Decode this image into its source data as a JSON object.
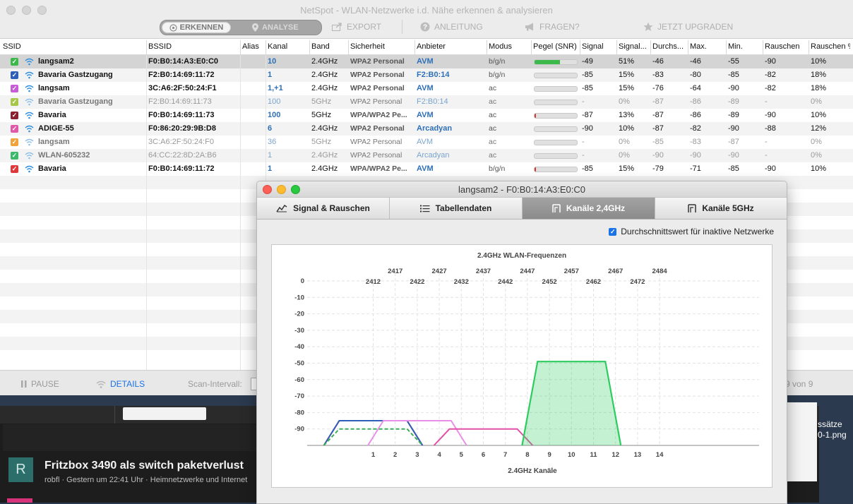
{
  "window": {
    "title": "NetSpot - WLAN-Netzwerke i.d. Nähe erkennen & analysieren"
  },
  "toolbar": {
    "mode_discover": "ERKENNEN",
    "mode_analyze": "ANALYSE",
    "export": "EXPORT",
    "guide": "ANLEITUNG",
    "ask": "FRAGEN?",
    "upgrade": "JETZT UPGRADEN"
  },
  "table": {
    "headers": [
      "SSID",
      "BSSID",
      "Alias",
      "Kanal",
      "Band",
      "Sicherheit",
      "Anbieter",
      "Modus",
      "Pegel (SNR)",
      "Signal",
      "Signal...",
      "Durchs...",
      "Max.",
      "Min.",
      "Rauschen",
      "Rauschen %"
    ],
    "rows": [
      {
        "color": "#3cb94a",
        "ssid": "langsam2",
        "bssid": "F0:B0:14:A3:E0:C0",
        "alias": "",
        "channel": "10",
        "band": "2.4GHz",
        "security": "WPA2 Personal",
        "vendor": "AVM",
        "mode": "b/g/n",
        "level": 0.6,
        "level_color": "#3cb94a",
        "signal": "-49",
        "signal_pct": "51%",
        "avg": "-46",
        "max": "-46",
        "min": "-55",
        "noise": "-90",
        "noise_pct": "10%",
        "active": true
      },
      {
        "color": "#2d5fb8",
        "ssid": "Bavaria Gastzugang",
        "bssid": "F2:B0:14:69:11:72",
        "alias": "",
        "channel": "1",
        "band": "2.4GHz",
        "security": "WPA2 Personal",
        "vendor": "F2:B0:14",
        "mode": "b/g/n",
        "level": 0.0,
        "level_color": "#d23a3a",
        "signal": "-85",
        "signal_pct": "15%",
        "avg": "-83",
        "max": "-80",
        "min": "-85",
        "noise": "-82",
        "noise_pct": "18%",
        "active": true
      },
      {
        "color": "#c85bd8",
        "ssid": "langsam",
        "bssid": "3C:A6:2F:50:24:F1",
        "alias": "",
        "channel": "1,+1",
        "band": "2.4GHz",
        "security": "WPA2 Personal",
        "vendor": "AVM",
        "mode": "ac",
        "level": 0.0,
        "level_color": "#d23a3a",
        "signal": "-85",
        "signal_pct": "15%",
        "avg": "-76",
        "max": "-64",
        "min": "-90",
        "noise": "-82",
        "noise_pct": "18%",
        "active": true
      },
      {
        "color": "#a7c74a",
        "ssid": "Bavaria Gastzugang",
        "bssid": "F2:B0:14:69:11:73",
        "alias": "",
        "channel": "100",
        "band": "5GHz",
        "security": "WPA2 Personal",
        "vendor": "F2:B0:14",
        "mode": "ac",
        "level": 0.0,
        "level_color": "#d23a3a",
        "signal": "-",
        "signal_pct": "0%",
        "avg": "-87",
        "max": "-86",
        "min": "-89",
        "noise": "-",
        "noise_pct": "0%",
        "active": false
      },
      {
        "color": "#8b1f2e",
        "ssid": "Bavaria",
        "bssid": "F0:B0:14:69:11:73",
        "alias": "",
        "channel": "100",
        "band": "5GHz",
        "security": "WPA/WPA2 Pe...",
        "vendor": "AVM",
        "mode": "ac",
        "level": 0.04,
        "level_color": "#d23a3a",
        "signal": "-87",
        "signal_pct": "13%",
        "avg": "-87",
        "max": "-86",
        "min": "-89",
        "noise": "-90",
        "noise_pct": "10%",
        "active": true
      },
      {
        "color": "#e158a8",
        "ssid": "ADIGE-55",
        "bssid": "F0:86:20:29:9B:D8",
        "alias": "",
        "channel": "6",
        "band": "2.4GHz",
        "security": "WPA2 Personal",
        "vendor": "Arcadyan",
        "mode": "ac",
        "level": 0.0,
        "level_color": "#d23a3a",
        "signal": "-90",
        "signal_pct": "10%",
        "avg": "-87",
        "max": "-82",
        "min": "-90",
        "noise": "-88",
        "noise_pct": "12%",
        "active": true
      },
      {
        "color": "#f1a23a",
        "ssid": "langsam",
        "bssid": "3C:A6:2F:50:24:F0",
        "alias": "",
        "channel": "36",
        "band": "5GHz",
        "security": "WPA2 Personal",
        "vendor": "AVM",
        "mode": "ac",
        "level": 0.0,
        "level_color": "#d23a3a",
        "signal": "-",
        "signal_pct": "0%",
        "avg": "-85",
        "max": "-83",
        "min": "-87",
        "noise": "-",
        "noise_pct": "0%",
        "active": false
      },
      {
        "color": "#3cb96a",
        "ssid": "WLAN-605232",
        "bssid": "64:CC:22:8D:2A:B6",
        "alias": "",
        "channel": "1",
        "band": "2.4GHz",
        "security": "WPA2 Personal",
        "vendor": "Arcadyan",
        "mode": "ac",
        "level": 0.0,
        "level_color": "#d23a3a",
        "signal": "-",
        "signal_pct": "0%",
        "avg": "-90",
        "max": "-90",
        "min": "-90",
        "noise": "-",
        "noise_pct": "0%",
        "active": false
      },
      {
        "color": "#e0383a",
        "ssid": "Bavaria",
        "bssid": "F0:B0:14:69:11:72",
        "alias": "",
        "channel": "1",
        "band": "2.4GHz",
        "security": "WPA/WPA2 Pe...",
        "vendor": "AVM",
        "mode": "b/g/n",
        "level": 0.04,
        "level_color": "#d23a3a",
        "signal": "-85",
        "signal_pct": "15%",
        "avg": "-79",
        "max": "-71",
        "min": "-85",
        "noise": "-90",
        "noise_pct": "10%",
        "active": true
      }
    ]
  },
  "statusbar": {
    "pause": "PAUSE",
    "details": "DETAILS",
    "scan_interval": "Scan-Intervall:",
    "count": "9 von 9"
  },
  "detail": {
    "title": "langsam2 - F0:B0:14:A3:E0:C0",
    "tabs": [
      "Signal & Rauschen",
      "Tabellendaten",
      "Kanäle 2,4GHz",
      "Kanäle 5GHz"
    ],
    "checkbox_label": "Durchschnittswert für inaktive Netzwerke"
  },
  "chart_data": {
    "type": "area",
    "title": "2.4GHz WLAN-Frequenzen",
    "xlabel": "2.4GHz Kanäle",
    "ylabel": "",
    "ylim": [
      -100,
      0
    ],
    "yticks": [
      0,
      -10,
      -20,
      -30,
      -40,
      -50,
      -60,
      -70,
      -80,
      -90
    ],
    "channels": [
      1,
      2,
      3,
      4,
      5,
      6,
      7,
      8,
      9,
      10,
      11,
      12,
      13,
      14
    ],
    "frequencies_top": [
      "2417",
      "2427",
      "2437",
      "2447",
      "2457",
      "2467",
      "2484"
    ],
    "frequencies_top_channels": [
      2,
      4,
      6,
      8,
      10,
      12,
      14
    ],
    "frequencies_bottom": [
      "2412",
      "2422",
      "2432",
      "2442",
      "2452",
      "2462",
      "2472"
    ],
    "frequencies_bottom_channels": [
      1,
      3,
      5,
      7,
      9,
      11,
      13
    ],
    "series": [
      {
        "name": "Bavaria",
        "channel": 1,
        "level": -85,
        "color": "#d6334f",
        "filled": false,
        "dashed": false
      },
      {
        "name": "Bavaria Gastzugang",
        "channel": 1,
        "level": -85,
        "color": "#2d5fb8",
        "filled": false,
        "dashed": false
      },
      {
        "name": "WLAN-605232",
        "channel": 1,
        "level": -90,
        "color": "#3cae5a",
        "filled": false,
        "dashed": true
      },
      {
        "name": "langsam",
        "channel": 3,
        "level": -85,
        "color": "#e88fe8",
        "filled": false,
        "dashed": false
      },
      {
        "name": "ADIGE-55",
        "channel": 6,
        "level": -90,
        "color": "#e14fa8",
        "filled": false,
        "dashed": false
      },
      {
        "name": "langsam2",
        "channel": 10,
        "level": -49,
        "color": "#2ecc60",
        "filled": true,
        "dashed": false
      }
    ]
  }
}
